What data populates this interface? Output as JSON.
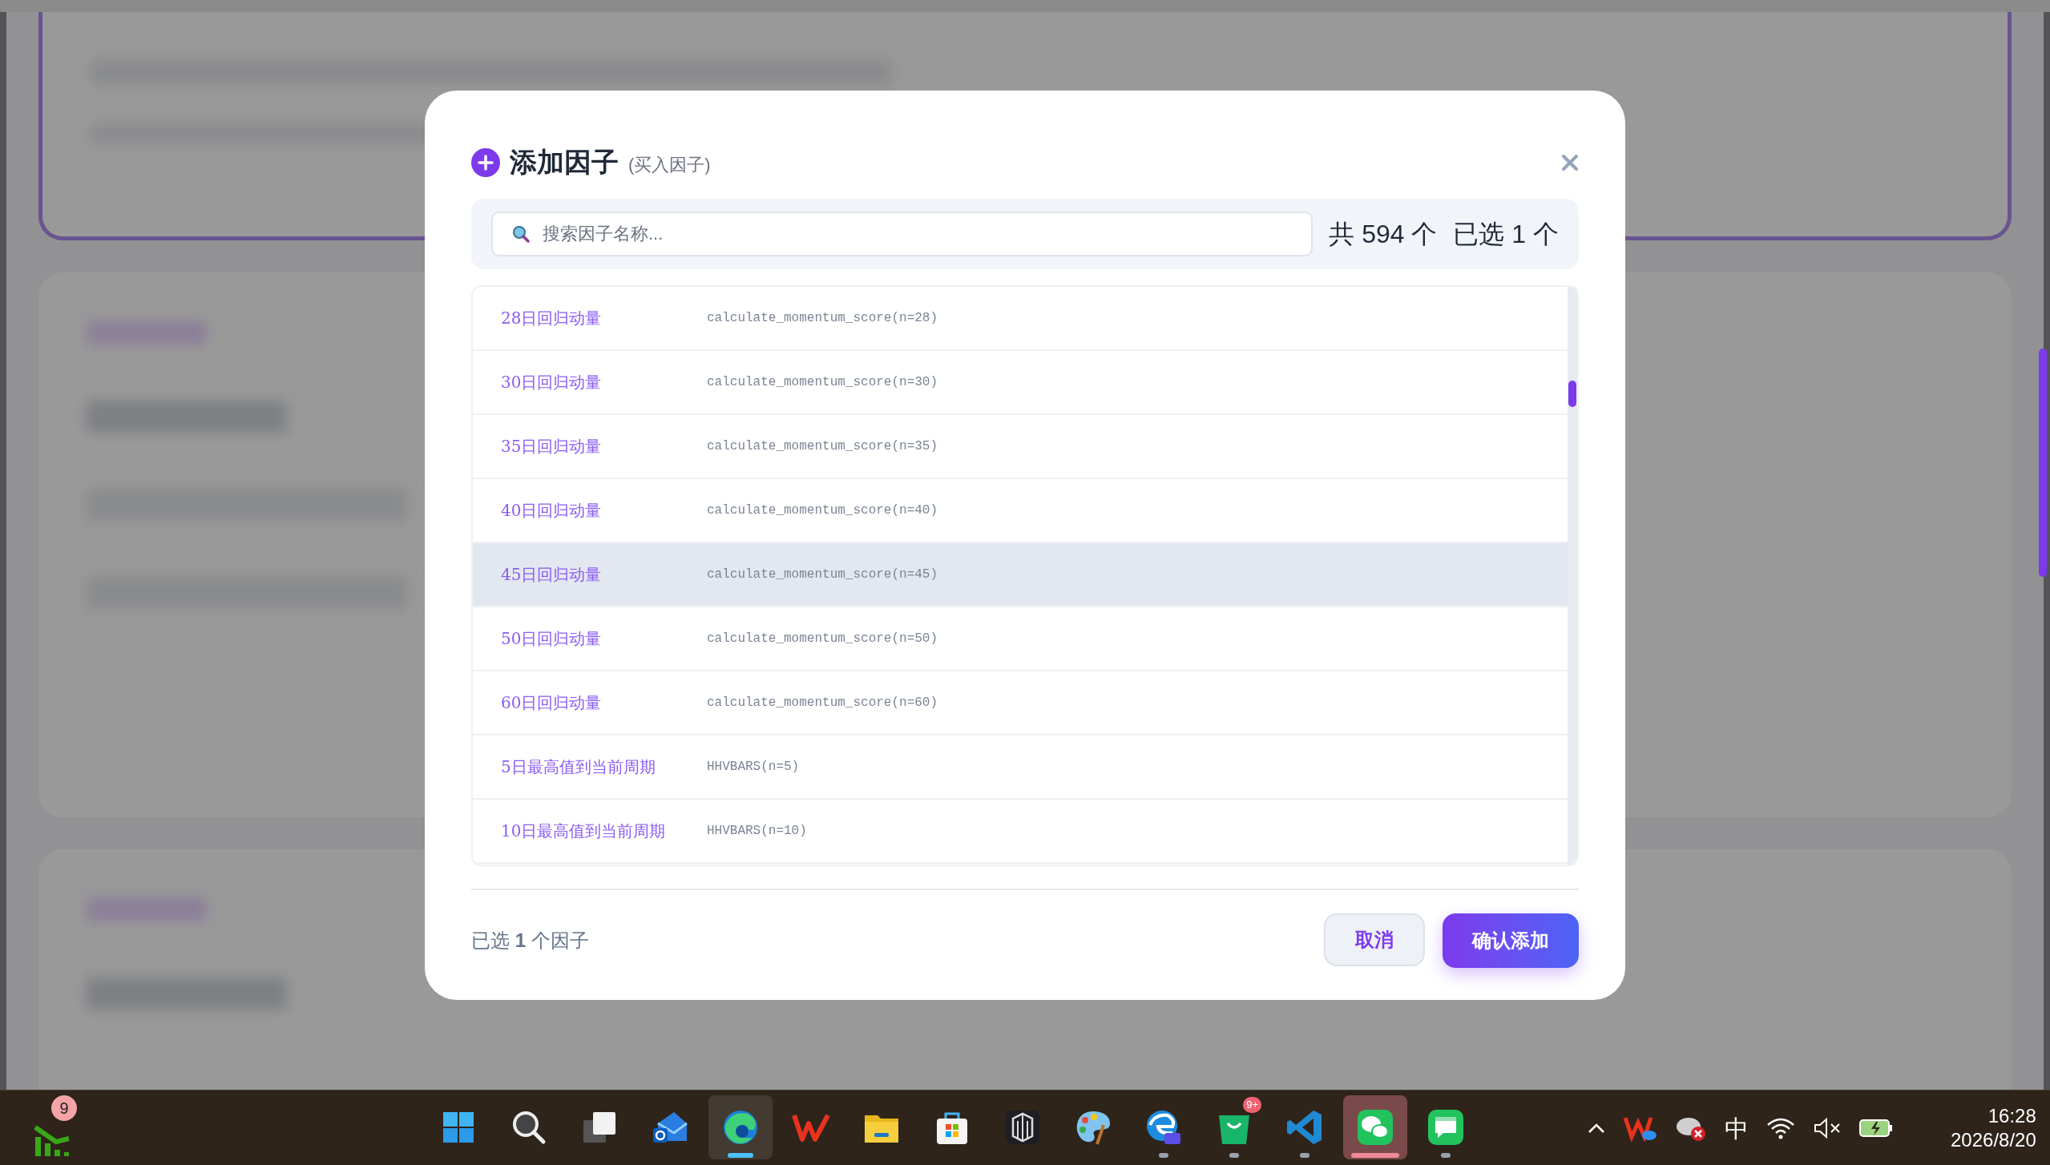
{
  "dialog": {
    "title": "添加因子",
    "subtitle": "(买入因子)",
    "search": {
      "placeholder": "搜索因子名称..."
    },
    "total": "共 594 个",
    "selected_count": "已选 1 个",
    "factors": [
      {
        "name": "28日回归动量",
        "code": "calculate_momentum_score(n=28)",
        "highlighted": false
      },
      {
        "name": "30日回归动量",
        "code": "calculate_momentum_score(n=30)",
        "highlighted": false
      },
      {
        "name": "35日回归动量",
        "code": "calculate_momentum_score(n=35)",
        "highlighted": false
      },
      {
        "name": "40日回归动量",
        "code": "calculate_momentum_score(n=40)",
        "highlighted": false
      },
      {
        "name": "45日回归动量",
        "code": "calculate_momentum_score(n=45)",
        "highlighted": true
      },
      {
        "name": "50日回归动量",
        "code": "calculate_momentum_score(n=50)",
        "highlighted": false
      },
      {
        "name": "60日回归动量",
        "code": "calculate_momentum_score(n=60)",
        "highlighted": false
      },
      {
        "name": "5日最高值到当前周期",
        "code": "HHVBARS(n=5)",
        "highlighted": false
      },
      {
        "name": "10日最高值到当前周期",
        "code": "HHVBARS(n=10)",
        "highlighted": false
      }
    ],
    "footer_text": "已选 **1** 个因子",
    "cancel_button": "取消",
    "confirm_button": "确认添加"
  },
  "taskbar": {
    "widget_badge": "9",
    "apps": [
      {
        "kind": "start",
        "active": false
      },
      {
        "kind": "search",
        "active": false
      },
      {
        "kind": "taskview",
        "active": false
      },
      {
        "kind": "outlook",
        "active": false
      },
      {
        "kind": "edge",
        "active": true
      },
      {
        "kind": "wps",
        "active": false
      },
      {
        "kind": "folder",
        "active": false
      },
      {
        "kind": "store",
        "active": false
      },
      {
        "kind": "cube",
        "active": false
      },
      {
        "kind": "palette",
        "active": false
      },
      {
        "kind": "edgeai",
        "active": false
      },
      {
        "kind": "bag",
        "active": false,
        "badge": "9+"
      },
      {
        "kind": "vscode",
        "active": false
      },
      {
        "kind": "wechat",
        "active": true
      },
      {
        "kind": "chat",
        "active": false
      }
    ],
    "input_method": "中",
    "time": "16:28",
    "date": "2026/8/20"
  }
}
